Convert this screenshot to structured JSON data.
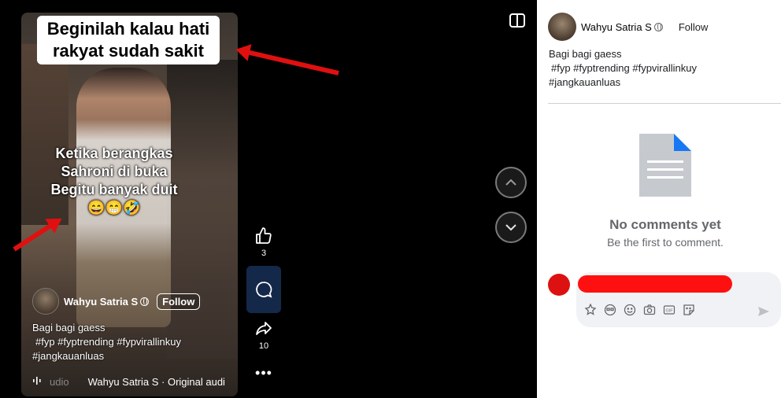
{
  "video": {
    "title_overlay_line1": "Beginilah kalau hati",
    "title_overlay_line2": "rakyat sudah sakit",
    "caption_line1": "Ketika berangkas",
    "caption_line2": "Sahroni di buka",
    "caption_line3": "Begitu banyak duit",
    "caption_emoji": "😄😁🤣",
    "author_name": "Wahyu Satria S",
    "follow_label": "Follow",
    "description": "Bagi bagi gaess",
    "hashtags_line1": "#fyp #fyptrending #fypvirallinkuy",
    "hashtags_line2": "#jangkauanluas",
    "audio_fade_text": "udio",
    "audio_text": "Wahyu Satria S · Original audi"
  },
  "actions": {
    "like_count": "3",
    "share_count": "10",
    "more_label": "•••"
  },
  "panel": {
    "author_name": "Wahyu Satria S",
    "follow_label": "Follow",
    "description": "Bagi bagi gaess",
    "hashtags_line1": "#fyp #fyptrending #fypvirallinkuy",
    "hashtags_line2": "#jangkauanluas",
    "no_comments_title": "No comments yet",
    "no_comments_sub": "Be the first to comment."
  },
  "colors": {
    "annotation_red": "#e01010",
    "comment_button_bg": "#14294a",
    "doc_icon_gray": "#c6cacf",
    "doc_icon_blue": "#1877f2"
  },
  "icons": [
    "switch-layout-icon",
    "chevron-up-icon",
    "chevron-down-icon",
    "thumbs-up-icon",
    "comment-icon",
    "share-icon",
    "more-icon",
    "globe-icon",
    "document-icon",
    "avatar-sticker-icon",
    "emoji-icon",
    "camera-icon",
    "gif-icon",
    "sticker-icon",
    "send-icon",
    "audio-waveform-icon"
  ]
}
